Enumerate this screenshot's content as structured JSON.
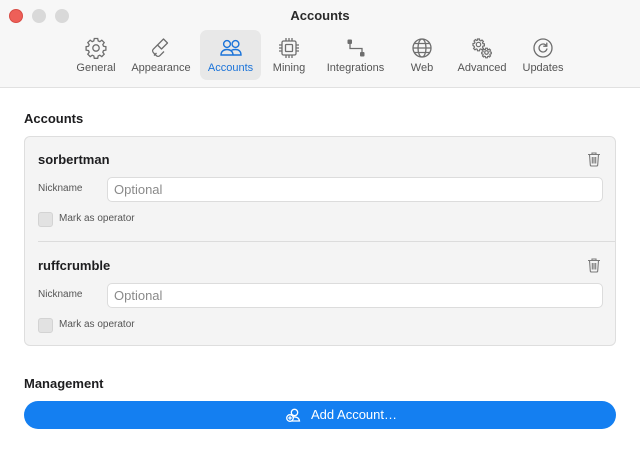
{
  "window": {
    "title": "Accounts"
  },
  "tabs": [
    {
      "label": "General",
      "icon": "gear-icon",
      "active": false
    },
    {
      "label": "Appearance",
      "icon": "paintbrush-icon",
      "active": false
    },
    {
      "label": "Accounts",
      "icon": "people-icon",
      "active": true
    },
    {
      "label": "Mining",
      "icon": "cpu-chip-icon",
      "active": false
    },
    {
      "label": "Integrations",
      "icon": "integrations-icon",
      "active": false
    },
    {
      "label": "Web",
      "icon": "globe-icon",
      "active": false
    },
    {
      "label": "Advanced",
      "icon": "gears-icon",
      "active": false
    },
    {
      "label": "Updates",
      "icon": "refresh-icon",
      "active": false
    }
  ],
  "accounts_section": {
    "title": "Accounts",
    "accounts": [
      {
        "name": "sorbertman",
        "nickname_label": "Nickname",
        "nickname_value": "",
        "nickname_placeholder": "Optional",
        "operator_label": "Mark as operator",
        "operator_checked": false
      },
      {
        "name": "ruffcrumble",
        "nickname_label": "Nickname",
        "nickname_value": "",
        "nickname_placeholder": "Optional",
        "operator_label": "Mark as operator",
        "operator_checked": false
      }
    ]
  },
  "management": {
    "title": "Management",
    "add_account_label": "Add Account…"
  },
  "colors": {
    "accent": "#147ff1",
    "active_tab_text": "#1a73d9",
    "close_button": "#ee5f58"
  }
}
